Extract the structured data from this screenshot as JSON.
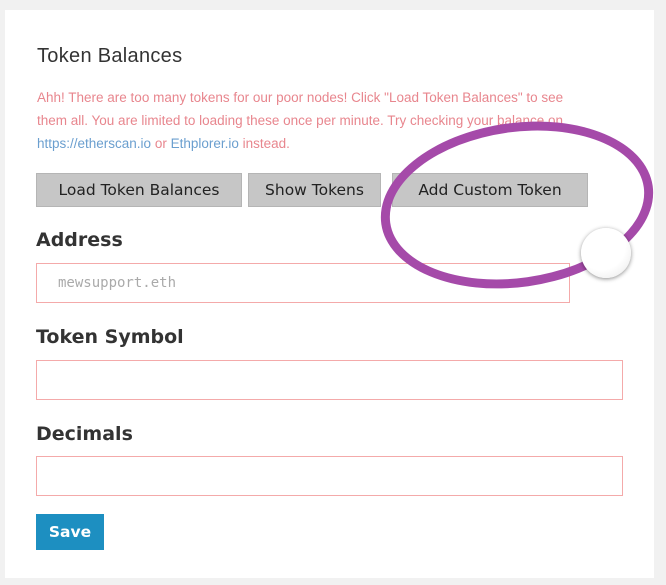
{
  "panel": {
    "title": "Token Balances",
    "warning": {
      "line1": "Ahh! There are too many tokens for our poor nodes! Click \"Load Token Balances\" to see",
      "line2": "them all. You are limited to loading these once per minute. Try checking your balance on",
      "link1": "https://etherscan.io",
      "mid": " or ",
      "link2": "Ethplorer.io",
      "end": " instead."
    }
  },
  "buttons": {
    "load": "Load Token Balances",
    "show": "Show Tokens",
    "add": "Add Custom Token",
    "save": "Save"
  },
  "form": {
    "address": {
      "label": "Address",
      "value": "",
      "placeholder": "mewsupport.eth"
    },
    "symbol": {
      "label": "Token Symbol",
      "value": "",
      "placeholder": ""
    },
    "decimals": {
      "label": "Decimals",
      "value": "",
      "placeholder": ""
    }
  },
  "colors": {
    "annotation": "#a54aa9",
    "warning_text": "#e8868e",
    "link": "#6b9fcf",
    "save_button": "#1d8fc1",
    "button_gray": "#c6c6c6",
    "input_border": "#f4aaaa"
  }
}
